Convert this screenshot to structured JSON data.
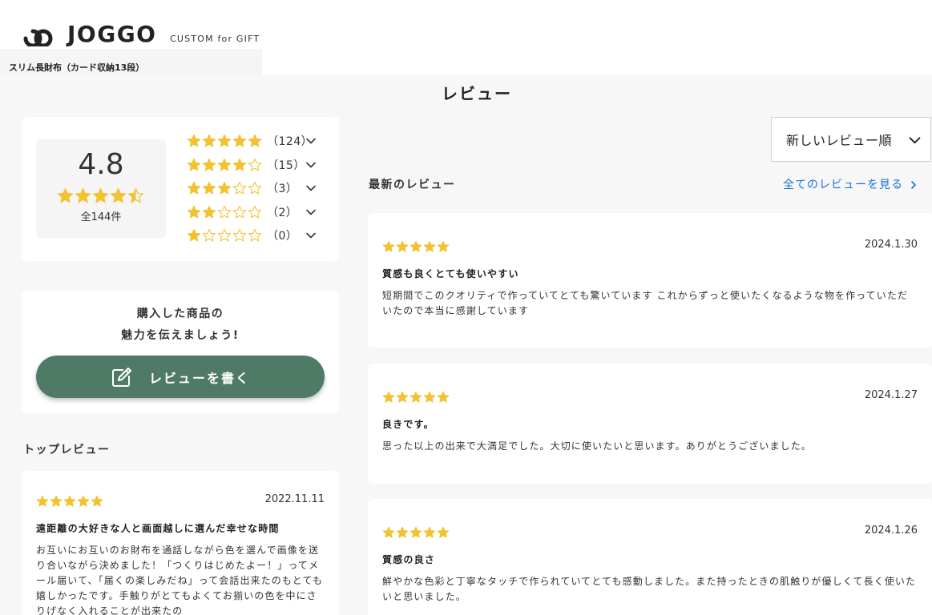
{
  "header": {
    "logo_text": "JOGGO",
    "logo_sub": "CUSTOM for GIFT",
    "breadcrumb": "スリム長財布（カード収納13段）"
  },
  "section_title": "レビュー",
  "colors": {
    "star": "#f2c230",
    "star_empty": "#f2c230",
    "accent_button": "#4f7a66",
    "link": "#1a6fd6",
    "background": "#f7f7f7"
  },
  "summary": {
    "average": "4.8",
    "average_rating": 4.5,
    "total_label": "全144件",
    "distribution": [
      {
        "stars": 5,
        "count": "（124）"
      },
      {
        "stars": 4,
        "count": "（15）"
      },
      {
        "stars": 3,
        "count": "（3）"
      },
      {
        "stars": 2,
        "count": "（2）"
      },
      {
        "stars": 1,
        "count": "（0）"
      }
    ]
  },
  "write": {
    "prompt_line1": "購入した商品の",
    "prompt_line2": "魅力を伝えましょう!",
    "button_label": "レビューを書く",
    "button_icon": "edit-icon"
  },
  "top_reviews": {
    "title": "トップレビュー",
    "items": [
      {
        "rating": 5,
        "date": "2022.11.11",
        "title": "遠距離の大好きな人と画面越しに選んだ幸せな時間",
        "body": "お互いにお互いのお財布を通話しながら色を選んで画像を送り合いながら決めました！「つくりはじめたよー！」ってメール届いて、「届くの楽しみだね」って会話出来たのもとても嬉しかったです。手触りがとてもよくてお揃いの色を中にさりげなく入れることが出来たの"
      }
    ]
  },
  "sort": {
    "label": "新しいレビュー順",
    "icon": "chevron-down-icon"
  },
  "latest_reviews": {
    "title": "最新のレビュー",
    "see_all": "全てのレビューを見る",
    "items": [
      {
        "rating": 5,
        "date": "2024.1.30",
        "title": "質感も良くとても使いやすい",
        "body": "短期間でこのクオリティで作っていてとても驚いています これからずっと使いたくなるような物を作っていただいたので本当に感謝しています"
      },
      {
        "rating": 5,
        "date": "2024.1.27",
        "title": "良きです。",
        "body": "思った以上の出来で大満足でした。大切に使いたいと思います。ありがとうございました。"
      },
      {
        "rating": 5,
        "date": "2024.1.26",
        "title": "質感の良さ",
        "body": "鮮やかな色彩と丁寧なタッチで作られていてとても感動しました。また持ったときの肌触りが優しくて長く使いたいと思いました。"
      }
    ]
  }
}
